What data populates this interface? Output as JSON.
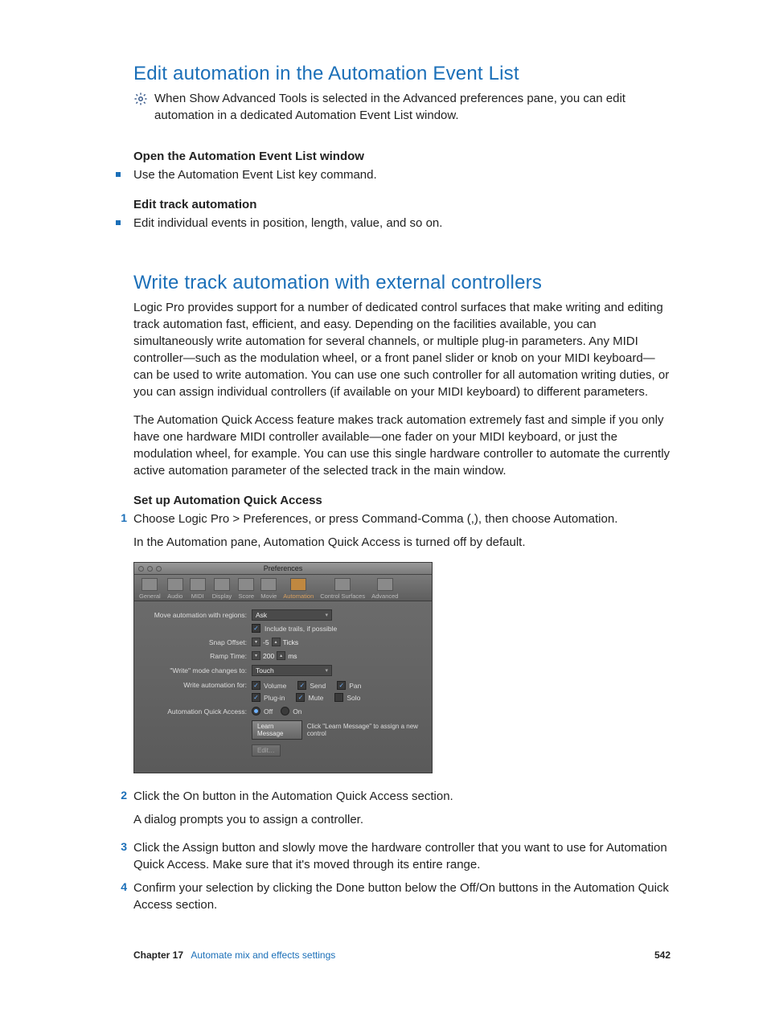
{
  "section1": {
    "heading": "Edit automation in the Automation Event List",
    "intro": "When Show Advanced Tools is selected in the Advanced preferences pane, you can edit automation in a dedicated Automation Event List window.",
    "sub1": "Open the Automation Event List window",
    "bullet1": "Use the Automation Event List key command.",
    "sub2": "Edit track automation",
    "bullet2": "Edit individual events in position, length, value, and so on."
  },
  "section2": {
    "heading": "Write track automation with external controllers",
    "p1": "Logic Pro provides support for a number of dedicated control surfaces that make writing and editing track automation fast, efficient, and easy. Depending on the facilities available, you can simultaneously write automation for several channels, or multiple plug-in parameters. Any MIDI controller—such as the modulation wheel, or a front panel slider or knob on your MIDI keyboard—can be used to write automation. You can use one such controller for all automation writing duties, or you can assign individual controllers (if available on your MIDI keyboard) to different parameters.",
    "p2": "The Automation Quick Access feature makes track automation extremely fast and simple if you only have one hardware MIDI controller available—one fader on your MIDI keyboard, or just the modulation wheel, for example. You can use this single hardware controller to automate the currently active automation parameter of the selected track in the main window.",
    "sub1": "Set up Automation Quick Access",
    "step1": "Choose Logic Pro > Preferences, or press Command-Comma (,), then choose Automation.",
    "step1b": "In the Automation pane, Automation Quick Access is turned off by default.",
    "step2": "Click the On button in the Automation Quick Access section.",
    "step2b": "A dialog prompts you to assign a controller.",
    "step3": "Click the Assign button and slowly move the hardware controller that you want to use for Automation Quick Access. Make sure that it's moved through its entire range.",
    "step4": "Confirm your selection by clicking the Done button below the Off/On buttons in the Automation Quick Access section."
  },
  "prefs": {
    "title": "Preferences",
    "tabs": [
      "General",
      "Audio",
      "MIDI",
      "Display",
      "Score",
      "Movie",
      "Automation",
      "Control Surfaces",
      "Advanced"
    ],
    "move_label": "Move automation with regions:",
    "move_value": "Ask",
    "include_trails": "Include trails, if possible",
    "snap_label": "Snap Offset:",
    "snap_value": "-5",
    "snap_unit": "Ticks",
    "ramp_label": "Ramp Time:",
    "ramp_value": "200",
    "ramp_unit": "ms",
    "write_mode_label": "\"Write\" mode changes to:",
    "write_mode_value": "Touch",
    "write_for_label": "Write automation for:",
    "chk_volume": "Volume",
    "chk_send": "Send",
    "chk_pan": "Pan",
    "chk_plugin": "Plug-in",
    "chk_mute": "Mute",
    "chk_solo": "Solo",
    "aqa_label": "Automation Quick Access:",
    "aqa_off": "Off",
    "aqa_on": "On",
    "btn_learn": "Learn Message",
    "hint": "Click \"Learn Message\" to assign a new control",
    "btn_edit": "Edit…"
  },
  "footer": {
    "chapter": "Chapter  17",
    "title": "Automate mix and effects settings",
    "page": "542"
  }
}
